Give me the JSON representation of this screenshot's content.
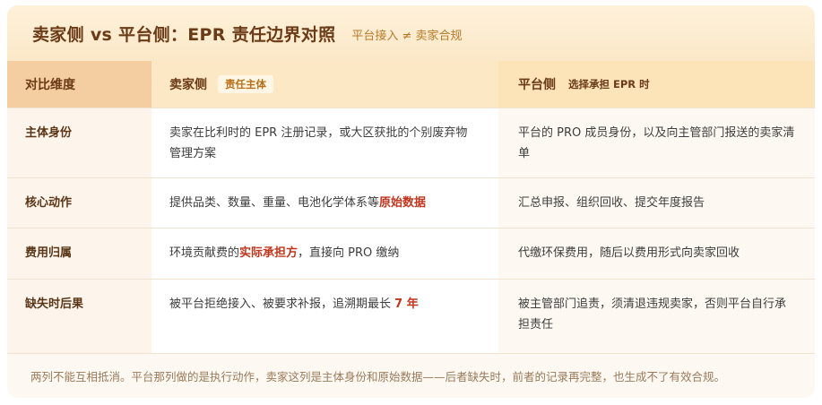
{
  "header": {
    "title": "卖家侧 vs 平台侧：EPR 责任边界对照",
    "subtitle": "平台接入 ≠ 卖家合规"
  },
  "table": {
    "columns": {
      "dimension": "对比维度",
      "seller": "卖家侧",
      "seller_tag": "责任主体",
      "platform": "平台侧",
      "platform_tag": "选择承担 EPR 时"
    },
    "rows": [
      {
        "dimension": "主体身份",
        "seller": "卖家在比利时的 EPR 注册记录，或大区获批的个别废弃物管理方案",
        "platform": "平台的 PRO 成员身份，以及向主管部门报送的卖家清单"
      },
      {
        "dimension": "核心动作",
        "seller_before": "提供品类、数量、重量、电池化学体系等",
        "seller_highlight": "原始数据",
        "platform": "汇总申报、组织回收、提交年度报告"
      },
      {
        "dimension": "费用归属",
        "seller_before": "环境贡献费的",
        "seller_highlight": "实际承担方",
        "seller_after": "，直接向 PRO 缴纳",
        "platform": "代缴环保费用，随后以费用形式向卖家回收"
      },
      {
        "dimension": "缺失时后果",
        "seller_before": "被平台拒绝接入、被要求补报，追溯期最长 ",
        "seller_highlight": "7 年",
        "platform": "被主管部门追责，须清退违规卖家，否则平台自行承担责任"
      }
    ]
  },
  "footer": {
    "note": "两列不能互相抵消。平台那列做的是执行动作，卖家这列是主体身份和原始数据——后者缺失时，前者的记录再完整，也生成不了有效合规。"
  },
  "colors": {
    "title": "#6b3a16",
    "highlight": "#c0361e",
    "header_bg": "#fef1da"
  }
}
